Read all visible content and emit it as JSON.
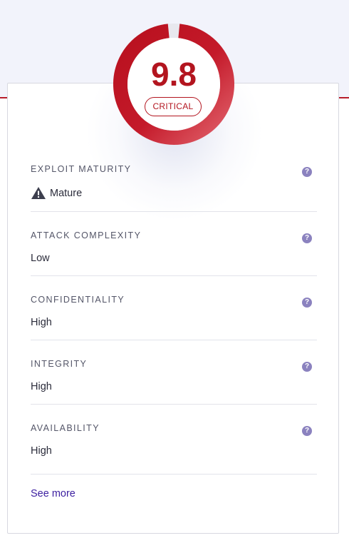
{
  "score": {
    "value": "9.8",
    "severity": "CRITICAL",
    "fill_fraction": 0.98,
    "accent_color": "#b3151f"
  },
  "metrics": [
    {
      "label": "EXPLOIT MATURITY",
      "value": "Mature",
      "icon": "warning-triangle-icon",
      "help": "?"
    },
    {
      "label": "ATTACK COMPLEXITY",
      "value": "Low",
      "help": "?"
    },
    {
      "label": "CONFIDENTIALITY",
      "value": "High",
      "help": "?"
    },
    {
      "label": "INTEGRITY",
      "value": "High",
      "help": "?"
    },
    {
      "label": "AVAILABILITY",
      "value": "High",
      "help": "?"
    }
  ],
  "see_more": "See more"
}
